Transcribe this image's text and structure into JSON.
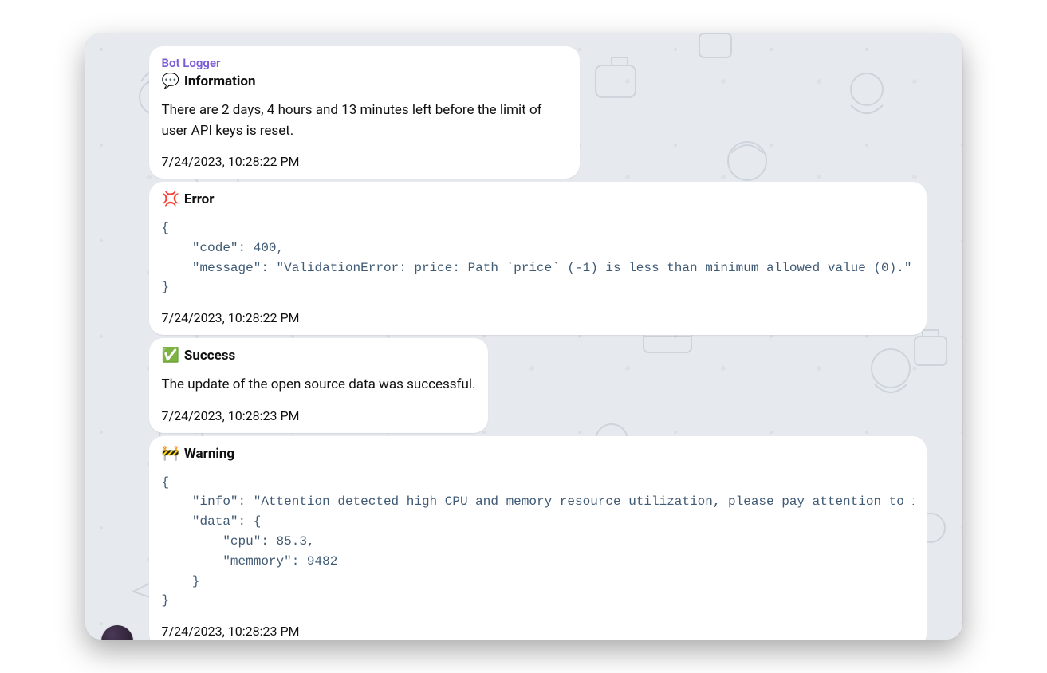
{
  "sender": "Bot Logger",
  "messages": [
    {
      "icon": "💬",
      "title": "Information",
      "body": "There are 2 days, 4 hours and 13 minutes left before the limit of user API keys is reset.",
      "timestamp": "7/24/2023, 10:28:22 PM",
      "width": "narrow"
    },
    {
      "icon": "💢",
      "title": "Error",
      "code": "{\n    \"code\": 400,\n    \"message\": \"ValidationError: price: Path `price` (-1) is less than minimum allowed value (0).\"\n}",
      "timestamp": "7/24/2023, 10:28:22 PM",
      "width": "wide"
    },
    {
      "icon": "✅",
      "title": "Success",
      "body": "The update of the open source data was successful.",
      "timestamp": "7/24/2023, 10:28:23 PM",
      "width": "narrow"
    },
    {
      "icon": "🚧",
      "title": "Warning",
      "code": "{\n    \"info\": \"Attention detected high CPU and memory resource utilization, please pay attention to it!\",\n    \"data\": {\n        \"cpu\": 85.3,\n        \"memmory\": 9482\n    }\n}",
      "timestamp": "7/24/2023, 10:28:23 PM",
      "width": "wide"
    }
  ]
}
